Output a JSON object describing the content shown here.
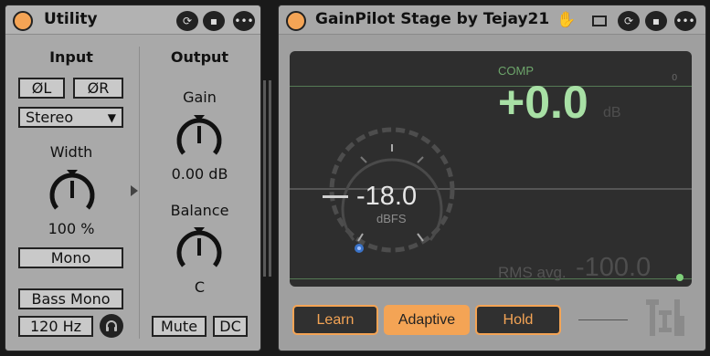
{
  "utility": {
    "title": "Utility",
    "input": {
      "heading": "Input",
      "phase_left": "ØL",
      "phase_right": "ØR",
      "channel_mode": "Stereo",
      "width_label": "Width",
      "width_value": "100 %",
      "mono_label": "Mono",
      "bass_mono_label": "Bass Mono",
      "bass_freq": "120 Hz"
    },
    "output": {
      "heading": "Output",
      "gain_label": "Gain",
      "gain_value": "0.00 dB",
      "balance_label": "Balance",
      "balance_value": "C",
      "mute_label": "Mute",
      "dc_label": "DC"
    }
  },
  "gainpilot": {
    "title": "GainPilot Stage by Tejay21",
    "display": {
      "comp_label": "COMP",
      "zero_label": "0",
      "comp_value": "+0.0",
      "comp_unit": "dB",
      "target_value": "-18.0",
      "target_unit": "dBFS",
      "rms_label": "RMS avg.",
      "rms_value": "-100.0"
    },
    "buttons": {
      "learn": "Learn",
      "adaptive": "Adaptive",
      "hold": "Hold"
    }
  },
  "colors": {
    "accent_orange": "#f4a455",
    "comp_green": "#a8e0a5",
    "display_bg": "#2e2e2e",
    "device_bg": "#a9a9a9"
  },
  "icons": [
    "power-icon",
    "refresh-icon",
    "save-icon",
    "more-icon",
    "hand-icon",
    "headphones-icon",
    "dropdown-arrow-icon",
    "logo-icon"
  ]
}
